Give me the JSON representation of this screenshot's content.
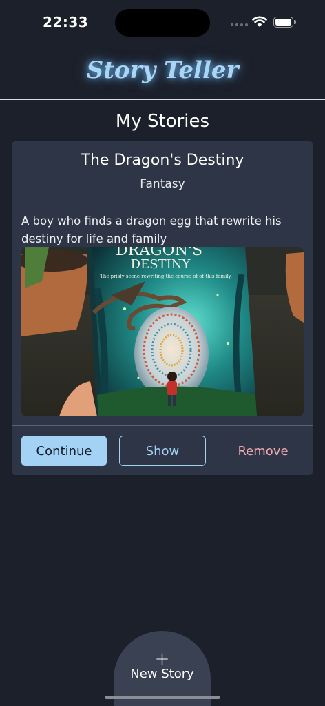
{
  "status_bar": {
    "time": "22:33"
  },
  "header": {
    "app_title": "Story Teller"
  },
  "page": {
    "title": "My Stories"
  },
  "stories": [
    {
      "title": "The Dragon's Destiny",
      "genre": "Fantasy",
      "description": "A boy who finds a dragon egg that rewrite his destiny for life and family",
      "cover": {
        "title_line1": "DRAGON'S",
        "title_line2": "DESTINY",
        "subtitle": "The prisly scene rewriting the course of of this family."
      },
      "actions": {
        "continue": "Continue",
        "show": "Show",
        "remove": "Remove"
      }
    }
  ],
  "bottom": {
    "new_story_icon": "+",
    "new_story_label": "New Story"
  },
  "colors": {
    "background": "#1c202a",
    "card": "#2e3546",
    "accent": "#a3d2f5",
    "danger": "#f2a9b0"
  }
}
